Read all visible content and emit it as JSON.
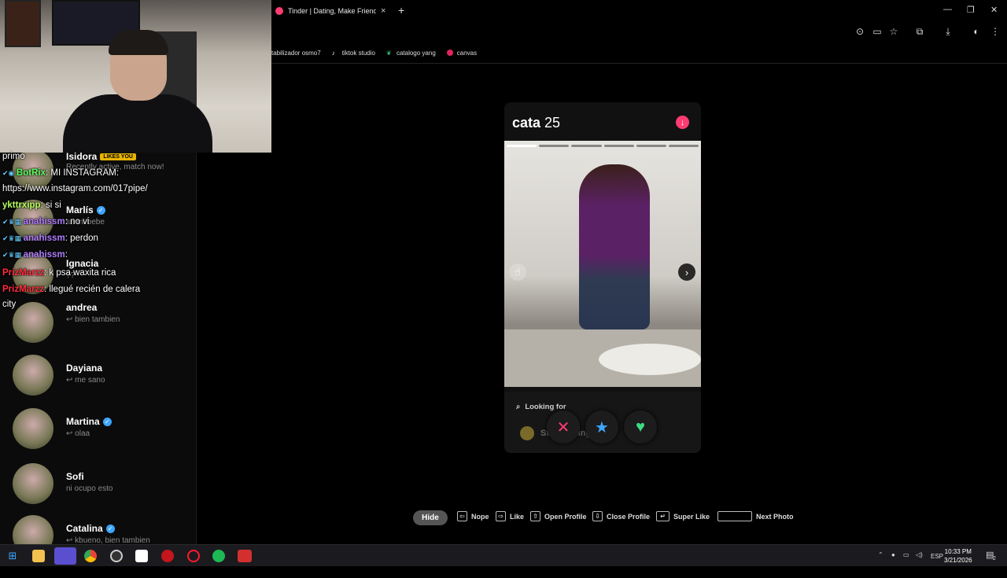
{
  "browser": {
    "tab_title": "Tinder | Dating, Make Friends &",
    "tab_close": "×",
    "new_tab": "+",
    "bookmarks": [
      {
        "label": "tabilizador osmo7",
        "icon": "bookmark-icon"
      },
      {
        "label": "tiktok studio",
        "icon": "tiktok-icon"
      },
      {
        "label": "catalogo yang",
        "icon": "leaf-icon"
      },
      {
        "label": "canvas",
        "icon": "canva-icon"
      }
    ]
  },
  "chat": [
    {
      "user": "",
      "text": "primo",
      "user_color": "#ffffff"
    },
    {
      "user": "BotRix",
      "text": ": MI INSTAGRAM:",
      "user_color": "#5cff5c"
    },
    {
      "user": "",
      "text": "https://www.instagram.com/017pipe/",
      "user_color": "#ffffff"
    },
    {
      "user": "ykttrxipp",
      "text": ": si si",
      "user_color": "#b8ff5c"
    },
    {
      "user": "anahissm",
      "text": ": no vi",
      "user_color": "#b07cff"
    },
    {
      "user": "anahissm",
      "text": ": perdon",
      "user_color": "#b07cff"
    },
    {
      "user": "anahissm",
      "text": ":",
      "user_color": "#b07cff"
    },
    {
      "user": "PrizMarzz",
      "text": ": k psa waxita rica",
      "user_color": "#ff2e3c"
    },
    {
      "user": "PrizMarzz",
      "text": ": llegué recién de calera",
      "user_color": "#ff2e3c"
    },
    {
      "user": "",
      "text": "city",
      "user_color": "#ffffff"
    }
  ],
  "matches": [
    {
      "name": "Isidora",
      "badge": "LIKES YOU",
      "message": "Recently active, match now!",
      "verified": false
    },
    {
      "name": "Marlís",
      "badge": "",
      "message": "tui mi bebe",
      "verified": true
    },
    {
      "name": "Ignacia",
      "badge": "",
      "message": "??",
      "verified": false
    },
    {
      "name": "andrea",
      "badge": "",
      "message": "↩ bien tambien",
      "verified": false
    },
    {
      "name": "Dayiana",
      "badge": "",
      "message": "↩ me sano",
      "verified": false
    },
    {
      "name": "Martina",
      "badge": "",
      "message": "↩ olaa",
      "verified": true
    },
    {
      "name": "Sofi",
      "badge": "",
      "message": "ni ocupo esto",
      "verified": false
    },
    {
      "name": "Catalina",
      "badge": "",
      "message": "↩ kbueno, bien tambien",
      "verified": true
    }
  ],
  "profile": {
    "name": "cata",
    "age": "25",
    "looking_for_label": "Looking for",
    "looking_for_value": "Still figuring it out",
    "photo_count": 6,
    "active_photo": 1
  },
  "actions": {
    "nope": "✕",
    "super_like": "★",
    "like": "♥"
  },
  "hints": {
    "hide": "Hide",
    "nope": "Nope",
    "like": "Like",
    "open_profile": "Open Profile",
    "close_profile": "Close Profile",
    "super_like": "Super Like",
    "next_photo": "Next Photo"
  },
  "taskbar": {
    "lang": "ESP",
    "time": "10:33 PM",
    "date": "3/21/2026",
    "notif_count": "2"
  },
  "colors": {
    "tinder_pink": "#fe3c72",
    "nope": "#fe3c72",
    "super_like": "#3ea6ff",
    "like": "#3ddc84"
  }
}
